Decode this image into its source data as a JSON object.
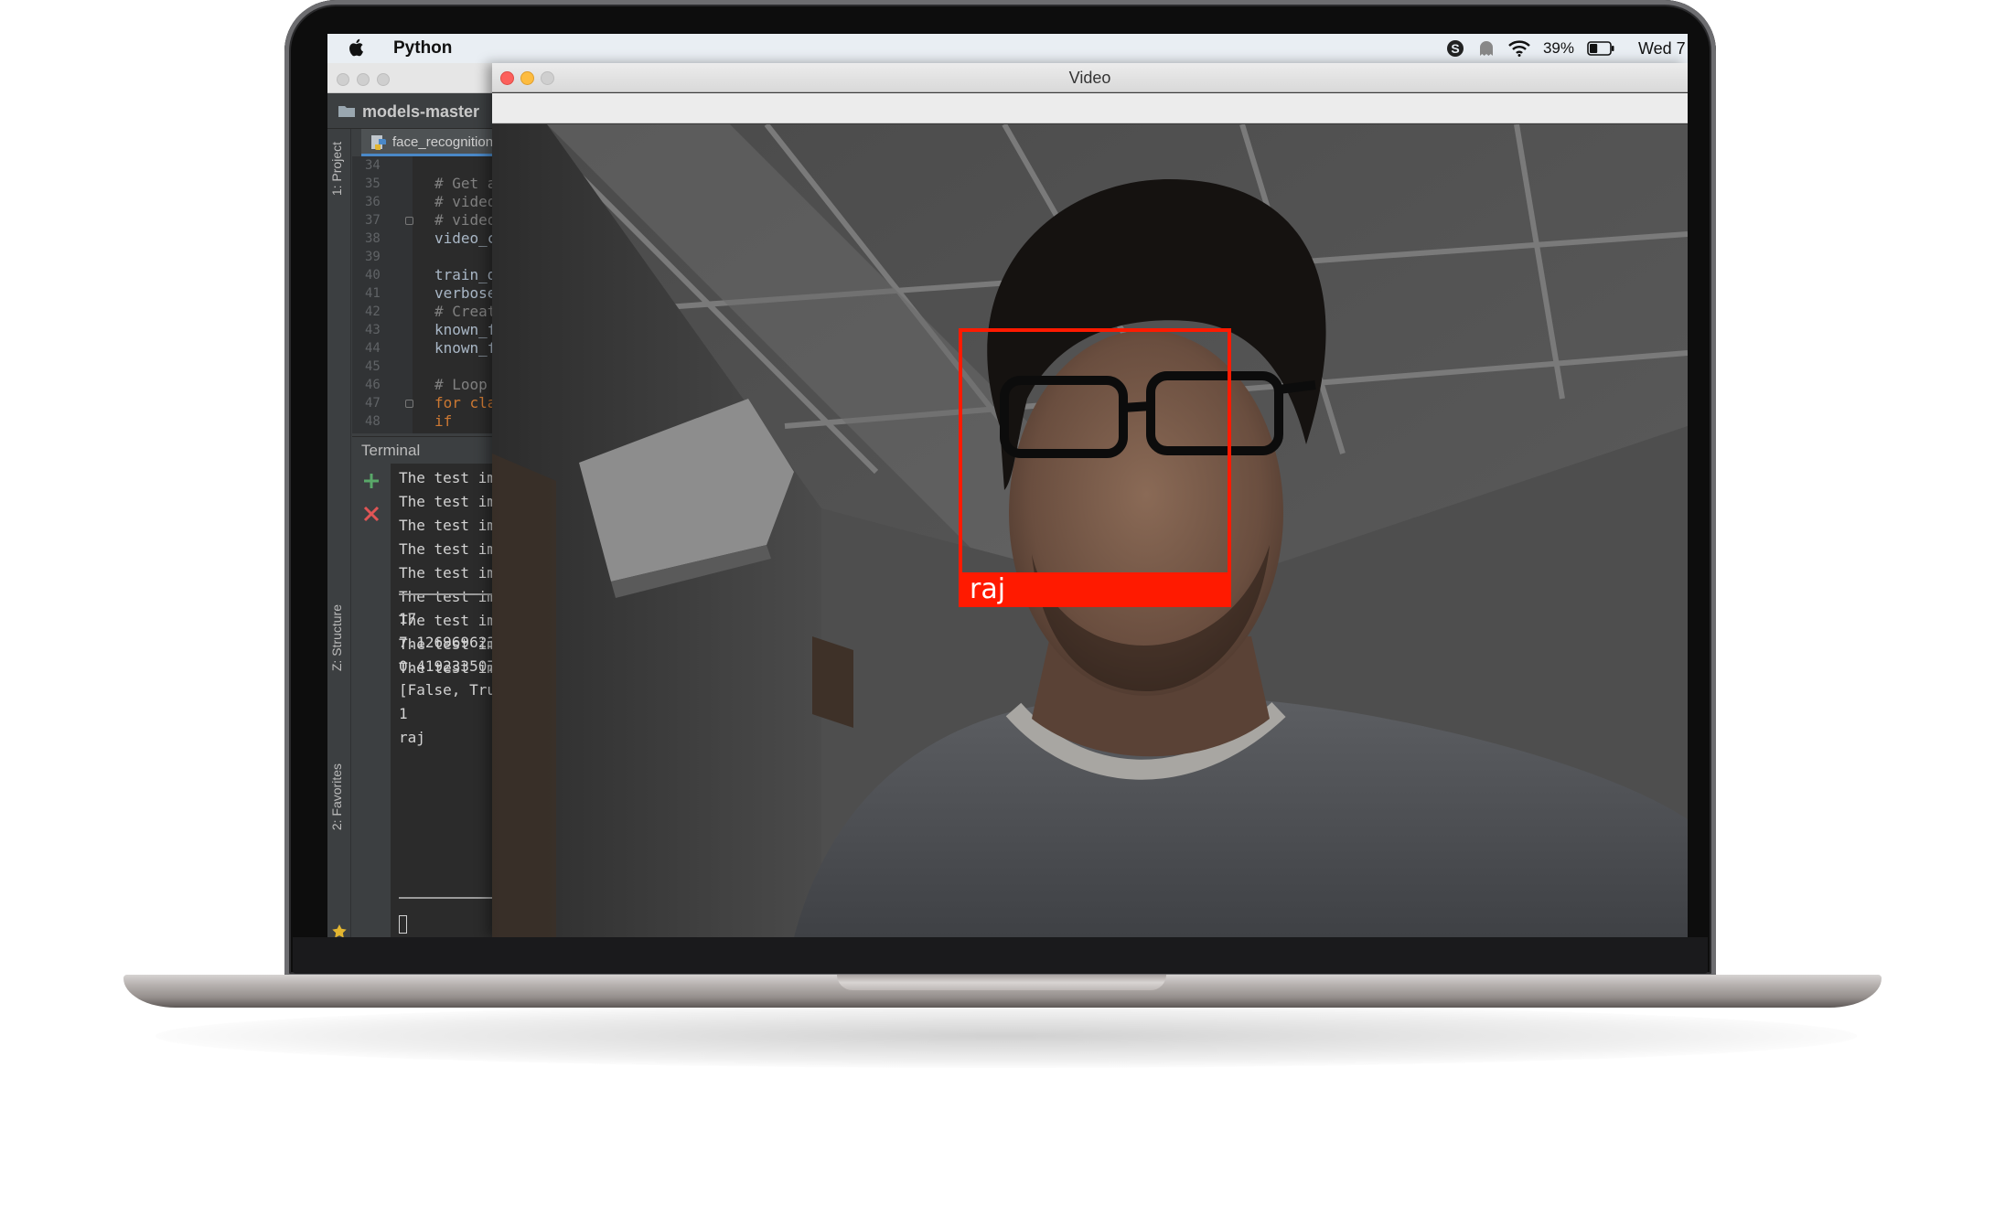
{
  "menubar": {
    "app_name": "Python",
    "battery_percent": "39%",
    "clock": "Wed 7"
  },
  "ide": {
    "breadcrumb": "models-master",
    "editor_tab": "face_recognition_",
    "side_tabs": {
      "project": "1: Project",
      "structure": "Z: Structure",
      "favorites": "2: Favorites"
    },
    "code_lines": [
      {
        "num": "34",
        "text": "",
        "kind": "code"
      },
      {
        "num": "35",
        "text": "# Get a",
        "kind": "comment"
      },
      {
        "num": "36",
        "text": "# video",
        "kind": "comment"
      },
      {
        "num": "37",
        "text": "# video",
        "kind": "comment"
      },
      {
        "num": "38",
        "text": "video_c",
        "kind": "code"
      },
      {
        "num": "39",
        "text": "",
        "kind": "code"
      },
      {
        "num": "40",
        "text": "train_d",
        "kind": "code"
      },
      {
        "num": "41",
        "text": "verbose",
        "kind": "code"
      },
      {
        "num": "42",
        "text": "# Creat",
        "kind": "comment"
      },
      {
        "num": "43",
        "text": "known_f",
        "kind": "code"
      },
      {
        "num": "44",
        "text": "known_f",
        "kind": "code"
      },
      {
        "num": "45",
        "text": "",
        "kind": "code"
      },
      {
        "num": "46",
        "text": "# Loop",
        "kind": "comment"
      },
      {
        "num": "47",
        "text": "for cla",
        "kind": "kw"
      },
      {
        "num": "48",
        "text": "    if",
        "kind": "kw"
      }
    ],
    "terminal_title": "Terminal",
    "terminal_lines": [
      "The test im",
      "The test im",
      "The test im",
      "The test im",
      "The test im",
      "The test im",
      "The test im",
      "The test im",
      "The test im",
      "17",
      "7.126969623",
      "0.419233507",
      "[False, Tru",
      "1",
      "raj"
    ]
  },
  "video_window": {
    "title": "Video",
    "detections": [
      {
        "label": "raj"
      }
    ]
  },
  "colors": {
    "detection_box": "#ff1a00",
    "traffic_close": "#fc605c",
    "traffic_min": "#fdbc40",
    "traffic_zoom_inactive": "#cfcfcf"
  }
}
